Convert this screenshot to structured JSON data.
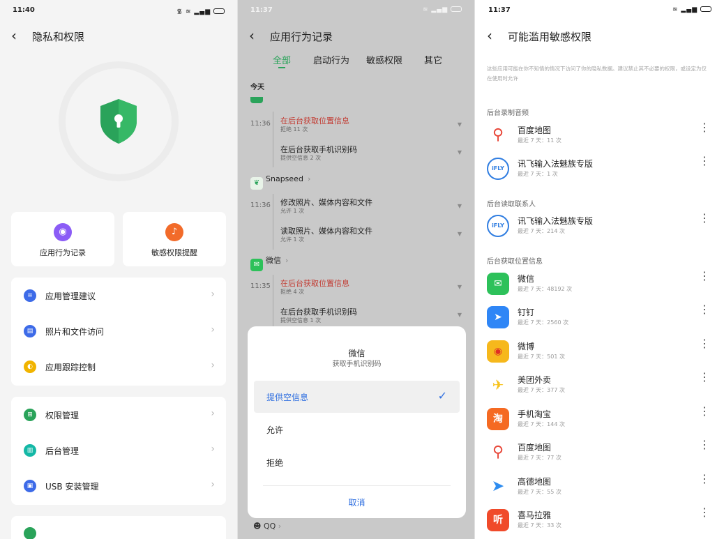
{
  "panels": {
    "privacy": {
      "status_time": "11:40",
      "status_signal": "436 ⫶ 35.5||",
      "title": "隐私和权限",
      "quick": [
        {
          "label": "应用行为记录",
          "icon": "eye-icon",
          "color": "#8b5cf6"
        },
        {
          "label": "敏感权限提醒",
          "icon": "bell-icon",
          "color": "#f26b2a"
        }
      ],
      "group1": [
        {
          "label": "应用管理建议",
          "icon": "message-icon",
          "color": "#3d6be8"
        },
        {
          "label": "照片和文件访问",
          "icon": "file-icon",
          "color": "#3d6be8"
        },
        {
          "label": "应用跟踪控制",
          "icon": "tracking-icon",
          "color": "#f1b400"
        }
      ],
      "group2": [
        {
          "label": "权限管理",
          "icon": "grid-icon",
          "color": "#2aa35a"
        },
        {
          "label": "后台管理",
          "icon": "background-icon",
          "color": "#14b8a6"
        },
        {
          "label": "USB 安装管理",
          "icon": "usb-icon",
          "color": "#3d6be8"
        }
      ]
    },
    "records": {
      "status_time": "11:37",
      "title": "应用行为记录",
      "tabs": [
        "全部",
        "启动行为",
        "敏感权限",
        "其它"
      ],
      "day": "今天",
      "entries": [
        {
          "time": "11:36",
          "title": "在后台获取位置信息",
          "sub": "拒绝 11 次",
          "red": true
        },
        {
          "time": "",
          "title": "在后台获取手机识别码",
          "sub": "提供空信息 2 次",
          "red": false
        },
        {
          "time": "11:36",
          "title": "修改照片、媒体内容和文件",
          "sub": "允许 1 次",
          "red": false
        },
        {
          "time": "",
          "title": "读取照片、媒体内容和文件",
          "sub": "允许 1 次",
          "red": false
        },
        {
          "time": "11:35",
          "title": "在后台获取位置信息",
          "sub": "拒绝 4 次",
          "red": true
        },
        {
          "time": "",
          "title": "在后台获取手机识别码",
          "sub": "提供空信息 1 次",
          "red": false
        }
      ],
      "apps": [
        "Snapseed",
        "微信"
      ],
      "peek_app": "QQ",
      "sheet": {
        "title": "微信",
        "subtitle": "获取手机识别码",
        "options": [
          "提供空信息",
          "允许",
          "拒绝"
        ],
        "selected": "提供空信息",
        "cancel": "取消"
      }
    },
    "sensitive": {
      "status_time": "11:37",
      "title": "可能滥用敏感权限",
      "description": "这些应用可能在你不知情的情况下访问了你的隐私数据。建议禁止其不必要的权限，或设定为仅在使用时允许",
      "sections": [
        {
          "title": "后台录制音频",
          "items": [
            {
              "name": "百度地图",
              "sub": "最近 7 天：11 次",
              "icon": "baidu-map-icon",
              "color": "#e8483a"
            },
            {
              "name": "讯飞输入法魅族专版",
              "sub": "最近 7 天：1 次",
              "icon": "ifly-icon",
              "color": "#2f7de1"
            }
          ]
        },
        {
          "title": "后台读取联系人",
          "items": [
            {
              "name": "讯飞输入法魅族专版",
              "sub": "最近 7 天：214 次",
              "icon": "ifly-icon",
              "color": "#2f7de1"
            }
          ]
        },
        {
          "title": "后台获取位置信息",
          "items": [
            {
              "name": "微信",
              "sub": "最近 7 天：48192 次",
              "icon": "wechat-icon",
              "color": "#2dc15a"
            },
            {
              "name": "钉钉",
              "sub": "最近 7 天：2560 次",
              "icon": "dingtalk-icon",
              "color": "#2f86f6"
            },
            {
              "name": "微博",
              "sub": "最近 7 天：501 次",
              "icon": "weibo-icon",
              "color": "#f6b81c"
            },
            {
              "name": "美团外卖",
              "sub": "最近 7 天：377 次",
              "icon": "meituan-icon",
              "color": "#f7c21a"
            },
            {
              "name": "手机淘宝",
              "sub": "最近 7 天：144 次",
              "icon": "taobao-icon",
              "color": "#f56a22"
            },
            {
              "name": "百度地图",
              "sub": "最近 7 天：77 次",
              "icon": "baidu-map-icon",
              "color": "#e8483a"
            },
            {
              "name": "高德地图",
              "sub": "最近 7 天：55 次",
              "icon": "amap-icon",
              "color": "#2d8cf0"
            },
            {
              "name": "喜马拉雅",
              "sub": "最近 7 天：33 次",
              "icon": "ximalaya-icon",
              "color": "#f04a2a"
            }
          ]
        }
      ]
    }
  }
}
